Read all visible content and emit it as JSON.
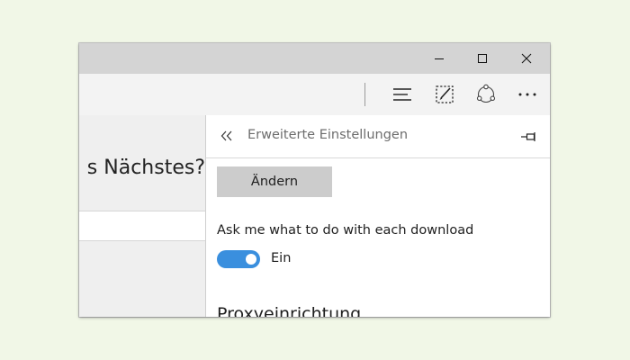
{
  "window": {
    "controls": {
      "minimize_icon": "minimize-icon",
      "maximize_icon": "maximize-icon",
      "close_icon": "close-icon"
    }
  },
  "toolbar": {
    "icons": [
      "hub-icon",
      "web-note-icon",
      "share-icon",
      "more-icon"
    ]
  },
  "page": {
    "heading": "s Nächstes?"
  },
  "settings_panel": {
    "title": "Erweiterte Einstellungen",
    "back_icon": "double-chevron-left-icon",
    "pin_icon": "pin-icon",
    "change_button_label": "Ändern",
    "download_setting": {
      "label": "Ask me what to do with each download",
      "toggle_on": true,
      "toggle_state_label": "Ein"
    },
    "proxy_section_heading": "Proxyeinrichtung"
  },
  "colors": {
    "background": "#f1f7e7",
    "titlebar": "#d4d4d4",
    "toolbar": "#f3f3f3",
    "toggle_on": "#3a8fde",
    "button": "#cccccc"
  }
}
